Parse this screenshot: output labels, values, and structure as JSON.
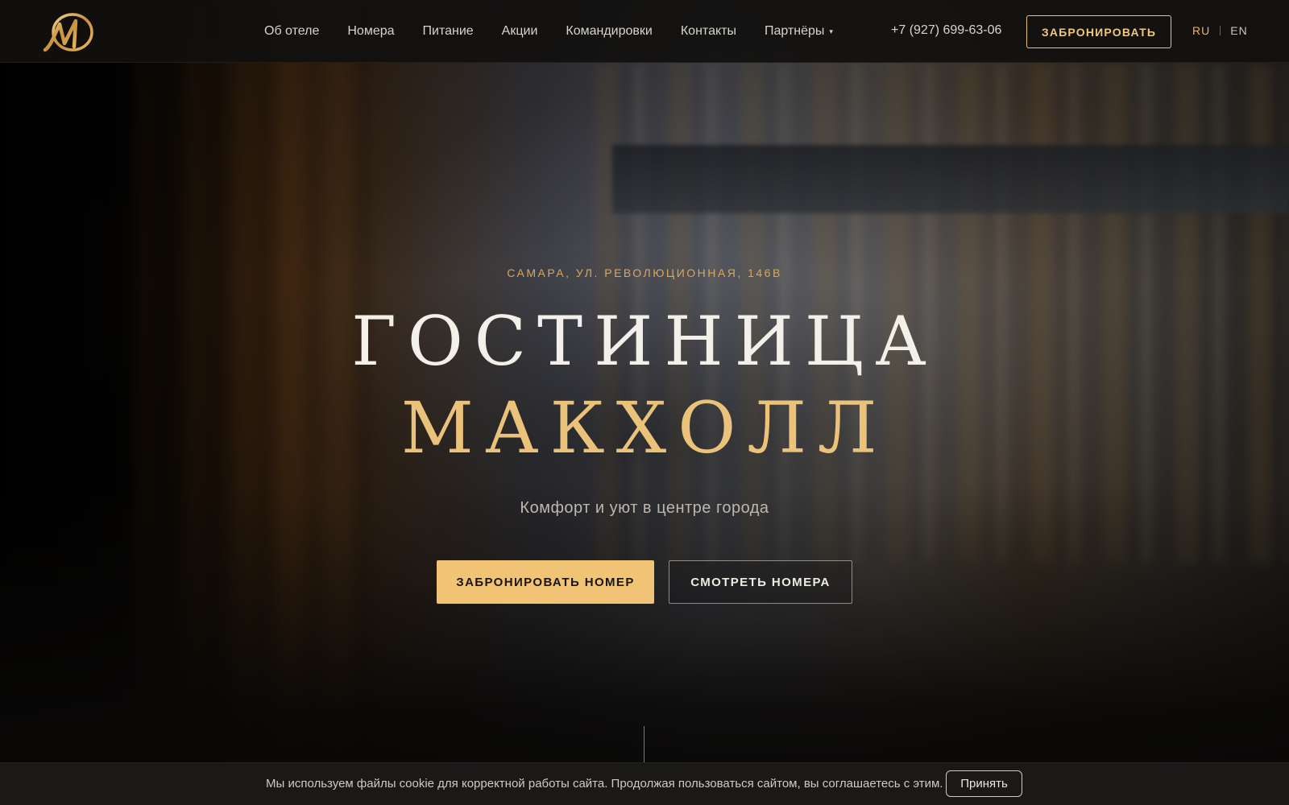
{
  "header": {
    "logo_icon": "hotel-monogram-logo",
    "nav": [
      {
        "label": "Об отеле"
      },
      {
        "label": "Номера"
      },
      {
        "label": "Питание"
      },
      {
        "label": "Акции"
      },
      {
        "label": "Командировки"
      },
      {
        "label": "Контакты"
      },
      {
        "label": "Партнёры",
        "has_dropdown": true
      }
    ],
    "dropdown_caret": "▾",
    "phone": "+7 (927) 699-63-06",
    "book_label": "ЗАБРОНИРОВАТЬ",
    "lang": {
      "ru": "RU",
      "en": "EN",
      "active": "RU"
    }
  },
  "hero": {
    "address": "САМАРА, УЛ. РЕВОЛЮЦИОННАЯ, 146В",
    "title_line1": "ГОСТИНИЦА",
    "title_line2": "МАКХОЛЛ",
    "tagline": "Комфорт и уют в центре города",
    "primary_button": "ЗАБРОНИРОВАТЬ НОМЕР",
    "secondary_button": "СМОТРЕТЬ НОМЕРА"
  },
  "cookie": {
    "text": "Мы используем файлы cookie для корректной работы сайта. Продолжая пользоваться сайтом, вы соглашаетесь с этим.",
    "accept_label": "Принять"
  },
  "colors": {
    "accent_gold": "#f0c474",
    "title_gold": "#ebc27a",
    "header_bg": "#11100f",
    "cookie_bg": "#1a1918"
  }
}
